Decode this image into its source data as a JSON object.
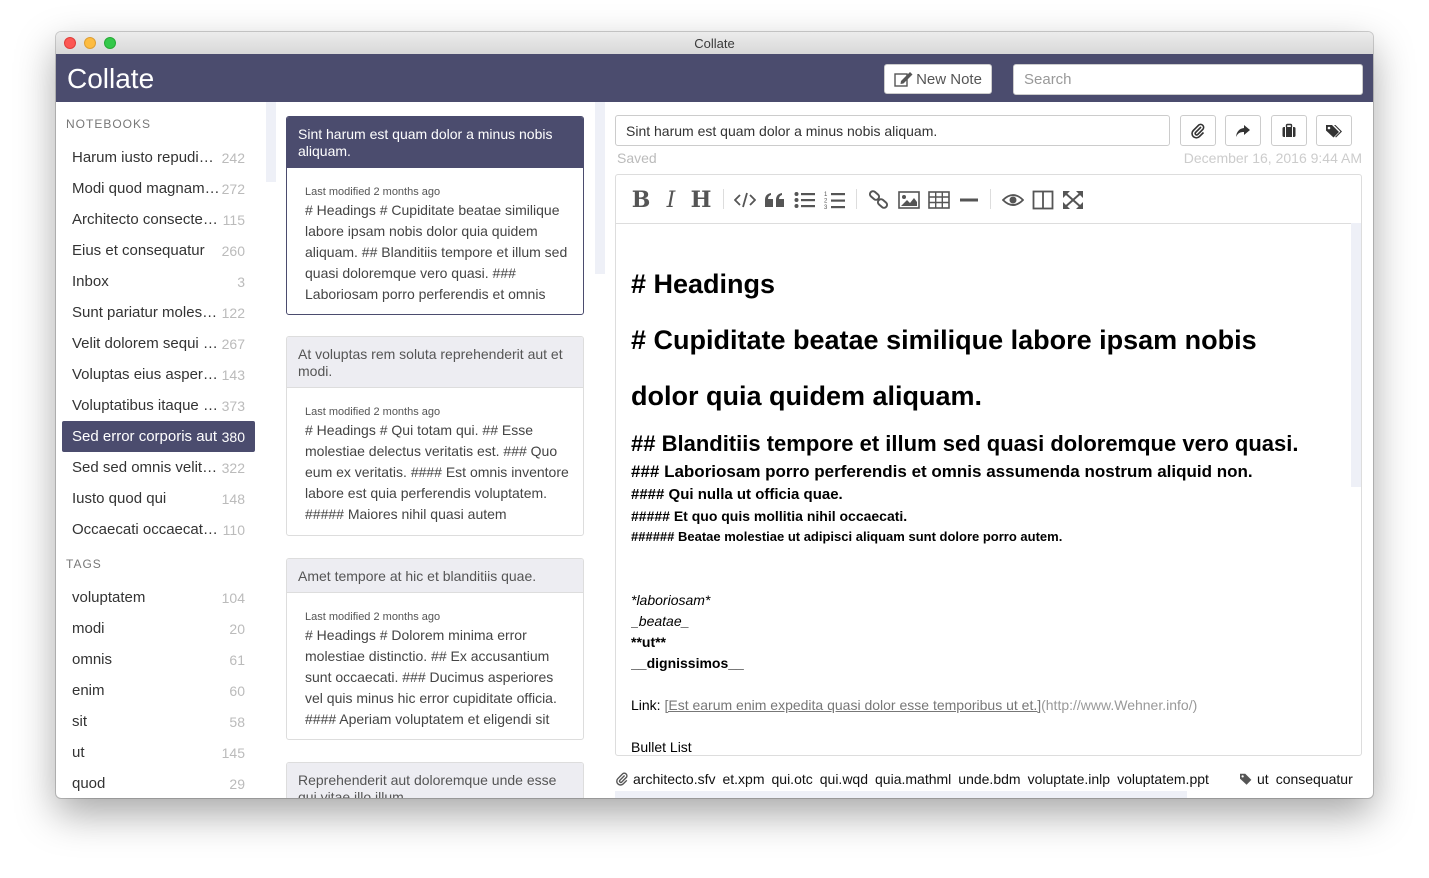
{
  "window": {
    "title": "Collate"
  },
  "app": {
    "brand": "Collate",
    "new_note_label": "New Note",
    "search_placeholder": "Search"
  },
  "sidebar": {
    "notebooks_heading": "NOTEBOOKS",
    "notebooks": [
      {
        "name": "Harum iusto repudiandae",
        "count": "242",
        "active": false
      },
      {
        "name": "Modi quod magnam dolorum",
        "count": "272",
        "active": false
      },
      {
        "name": "Architecto consectetur",
        "count": "115",
        "active": false
      },
      {
        "name": "Eius et consequatur",
        "count": "260",
        "active": false
      },
      {
        "name": "Inbox",
        "count": "3",
        "active": false
      },
      {
        "name": "Sunt pariatur molestias",
        "count": "122",
        "active": false
      },
      {
        "name": "Velit dolorem sequi eos",
        "count": "267",
        "active": false
      },
      {
        "name": "Voluptas eius aspernatur",
        "count": "143",
        "active": false
      },
      {
        "name": "Voluptatibus itaque quis",
        "count": "373",
        "active": false
      },
      {
        "name": "Sed error corporis aut",
        "count": "380",
        "active": true
      },
      {
        "name": "Sed sed omnis velit est",
        "count": "322",
        "active": false
      },
      {
        "name": "Iusto quod qui",
        "count": "148",
        "active": false
      },
      {
        "name": "Occaecati occaecati ut",
        "count": "110",
        "active": false
      }
    ],
    "tags_heading": "TAGS",
    "tags": [
      {
        "name": "voluptatem",
        "count": "104"
      },
      {
        "name": "modi",
        "count": "20"
      },
      {
        "name": "omnis",
        "count": "61"
      },
      {
        "name": "enim",
        "count": "60"
      },
      {
        "name": "sit",
        "count": "58"
      },
      {
        "name": "ut",
        "count": "145"
      },
      {
        "name": "quod",
        "count": "29"
      }
    ]
  },
  "notes": [
    {
      "title": "Sint harum est quam dolor a minus nobis aliquam.",
      "meta": "Last modified 2 months ago",
      "preview": "# Headings # Cupiditate beatae similique labore ipsam nobis dolor quia quidem aliquam. ## Blanditiis tempore et illum sed quasi doloremque vero quasi. ### Laboriosam porro perferendis et omnis",
      "active": true
    },
    {
      "title": "At voluptas rem soluta reprehenderit aut et modi.",
      "meta": "Last modified 2 months ago",
      "preview": "# Headings # Qui totam qui. ## Esse molestiae delectus veritatis est. ### Quo eum ex veritatis. #### Est omnis inventore labore est quia perferendis voluptatem. ##### Maiores nihil quasi autem aspernatur",
      "active": false
    },
    {
      "title": "Amet tempore at hic et blanditiis quae.",
      "meta": "Last modified 2 months ago",
      "preview": "# Headings # Dolorem minima error molestiae distinctio. ## Ex accusantium sunt occaecati. ### Ducimus asperiores vel quis minus hic error cupiditate officia. #### Aperiam voluptatem et eligendi sit",
      "active": false
    },
    {
      "title": "Reprehenderit aut doloremque unde esse qui vitae illo illum.",
      "meta": "",
      "preview": "",
      "active": false
    }
  ],
  "editor": {
    "title_value": "Sint harum est quam dolor a minus nobis aliquam.",
    "saved_label": "Saved",
    "date": "December 16, 2016 9:44 AM",
    "toolbar_icons": [
      "bold-icon",
      "italic-icon",
      "heading-icon",
      "code-icon",
      "quote-icon",
      "unordered-list-icon",
      "ordered-list-icon",
      "link-icon",
      "image-icon",
      "table-icon",
      "horizontal-rule-icon",
      "preview-eye-icon",
      "side-by-side-icon",
      "fullscreen-icon"
    ],
    "action_icons": [
      "paperclip-icon",
      "share-icon",
      "briefcase-icon",
      "tags-icon"
    ],
    "content": {
      "h1a": "# Headings",
      "h1b": "# Cupiditate beatae similique labore ipsam nobis",
      "h1c": "dolor quia quidem aliquam.",
      "h2": "## Blanditiis tempore et illum sed quasi doloremque vero quasi.",
      "h3": "### Laboriosam porro perferendis et omnis assumenda nostrum aliquid non.",
      "h4": "#### Qui nulla ut officia quae.",
      "h5": "##### Et quo quis mollitia nihil occaecati.",
      "h6": "###### Beatae molestiae ut adipisci aliquam sunt dolore porro autem.",
      "em1": "*laboriosam*",
      "em2": "_beatae_",
      "strong1": "**ut**",
      "strong2": "__dignissimos__",
      "link_label": "Link: ",
      "link_text": "[Est earum enim expedita quasi dolor esse temporibus ut et.]",
      "link_url": "(http://www.Wehner.info/)",
      "bullet_heading": "Bullet List"
    }
  },
  "footer": {
    "attachments": [
      "architecto.sfv",
      "et.xpm",
      "qui.otc",
      "qui.wqd",
      "quia.mathml",
      "unde.bdm",
      "voluptate.inlp",
      "voluptatem.ppt"
    ],
    "tags": [
      "ut",
      "consequatur"
    ]
  },
  "colors": {
    "accent": "#4b4c6e",
    "scrollbar": "#eef0f7"
  }
}
